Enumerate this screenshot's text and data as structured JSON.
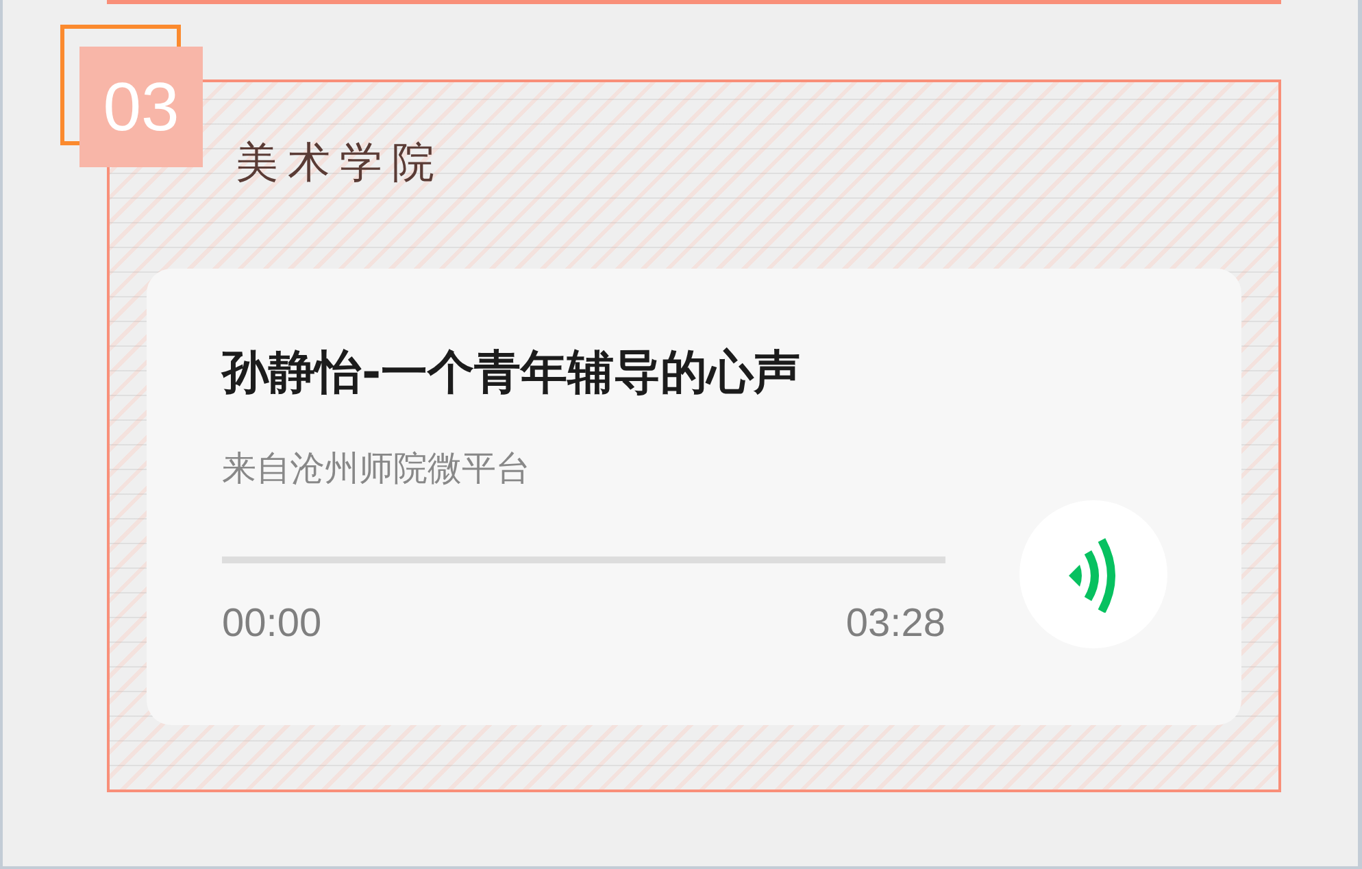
{
  "section": {
    "number": "03",
    "title": "美术学院"
  },
  "audio": {
    "title": "孙静怡-一个青年辅导的心声",
    "source": "来自沧州师院微平台",
    "level": 0,
    "elapsed": "00:00",
    "duration": "03:28",
    "playing": false
  }
}
